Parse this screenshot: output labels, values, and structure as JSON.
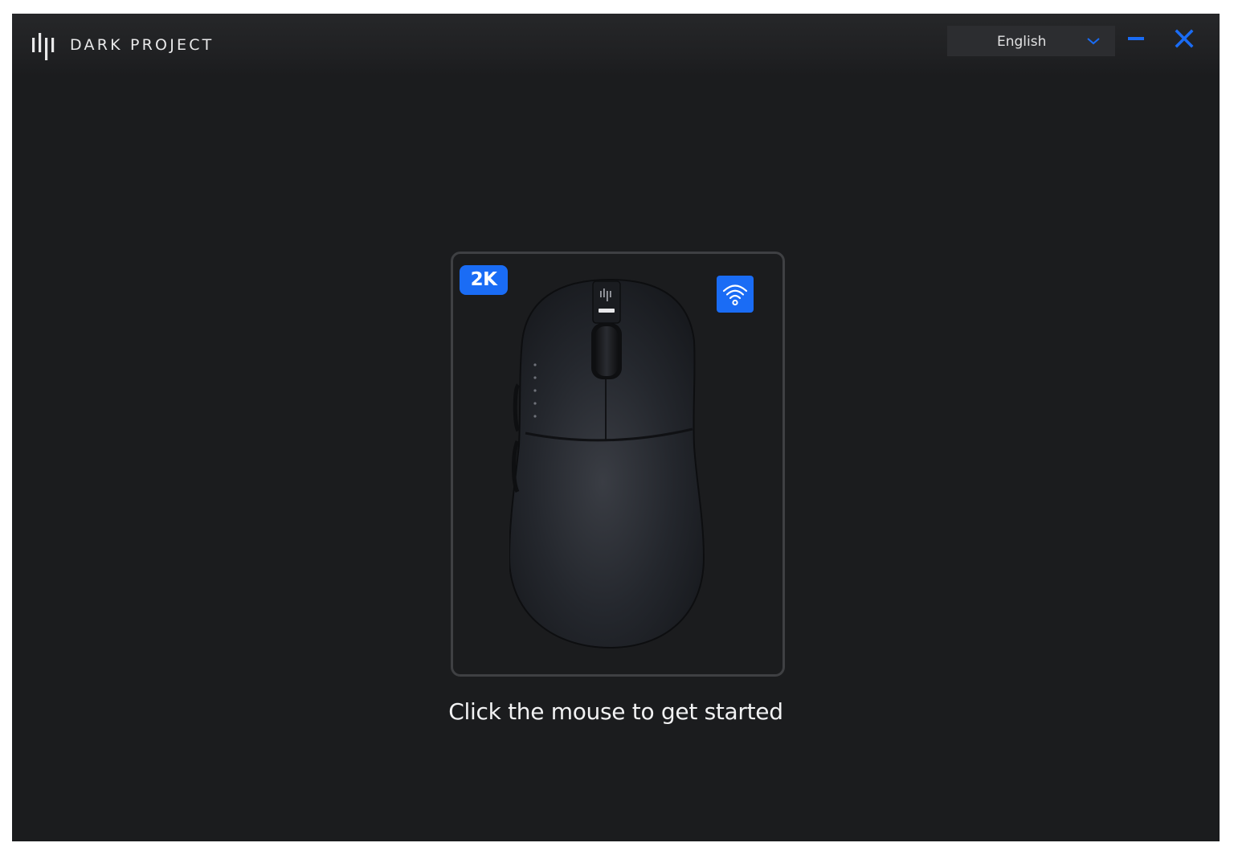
{
  "app": {
    "brand": "DARK PROJECT"
  },
  "header": {
    "language": {
      "selected": "English"
    }
  },
  "device": {
    "polling_badge": "2K",
    "connection_icon": "wifi-icon",
    "image_icon": "mouse-icon"
  },
  "main": {
    "prompt": "Click the mouse to get started"
  },
  "colors": {
    "background": "#1b1c1e",
    "accent": "#1a6cf5",
    "card_border": "#3f4043",
    "text": "#f2f2f3"
  }
}
